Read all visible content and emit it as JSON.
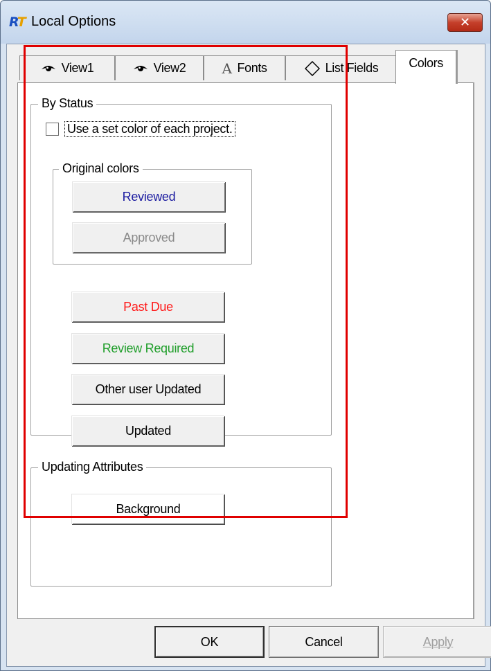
{
  "window": {
    "title": "Local Options",
    "close_label": "✕"
  },
  "tabs": [
    {
      "label": "View1",
      "icon": "eye-icon"
    },
    {
      "label": "View2",
      "icon": "eye-icon"
    },
    {
      "label": "Fonts",
      "icon": "font-icon"
    },
    {
      "label": "List Fields",
      "icon": "diamond-icon"
    },
    {
      "label": "Colors",
      "icon": "",
      "active": true
    }
  ],
  "by_status": {
    "label": "By Status",
    "checkbox_label": "Use a set color of each project.",
    "checked": false,
    "original_colors": {
      "label": "Original colors",
      "reviewed": {
        "label": "Reviewed",
        "color": "#1a1aa0"
      },
      "approved": {
        "label": "Approved",
        "color": "#8a8a8a"
      }
    },
    "past_due": {
      "label": "Past Due",
      "color": "#ff1a1a"
    },
    "review_required": {
      "label": "Review Required",
      "color": "#1f9e2a"
    },
    "other_user_updated": {
      "label": "Other user Updated",
      "color": "#000000"
    },
    "updated": {
      "label": "Updated",
      "color": "#000000"
    }
  },
  "updating_attributes": {
    "label": "Updating Attributes",
    "background": {
      "label": "Background"
    }
  },
  "footer": {
    "ok": "OK",
    "cancel": "Cancel",
    "apply": "Apply"
  }
}
